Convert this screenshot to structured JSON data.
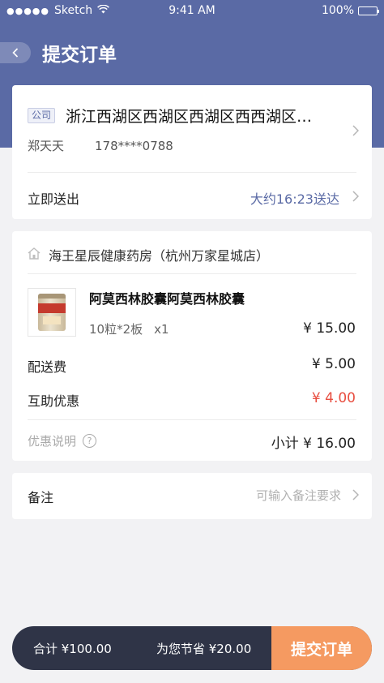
{
  "status_bar": {
    "carrier": "Sketch",
    "time": "9:41 AM",
    "battery": "100%"
  },
  "header": {
    "title": "提交订单"
  },
  "address": {
    "tag": "公司",
    "text": "浙江西湖区西湖区西湖区西西湖区…",
    "name": "郑天天",
    "phone": "178****0788"
  },
  "delivery": {
    "label": "立即送出",
    "eta": "大约16:23送达"
  },
  "order": {
    "store": "海王星辰健康药房（杭州万家星城店）",
    "product": {
      "name": "阿莫西林胶囊阿莫西林胶囊",
      "spec": "10粒*2板",
      "qty": "x1",
      "price": "¥ 15.00"
    },
    "fees": [
      {
        "label": "配送费",
        "value": "¥ 5.00"
      },
      {
        "label": "互助优惠",
        "value": "¥ 4.00"
      }
    ],
    "promo_label": "优惠说明",
    "subtotal": "小计 ¥ 16.00"
  },
  "remark": {
    "label": "备注",
    "placeholder": "可输入备注要求"
  },
  "footer": {
    "total": "合计 ¥100.00",
    "saved": "为您节省 ¥20.00",
    "submit_label": "提交订单"
  },
  "colors": {
    "brand": "#5a6aa5",
    "accent": "#f59a61",
    "discount": "#e84e40",
    "bar": "#2f3447"
  }
}
